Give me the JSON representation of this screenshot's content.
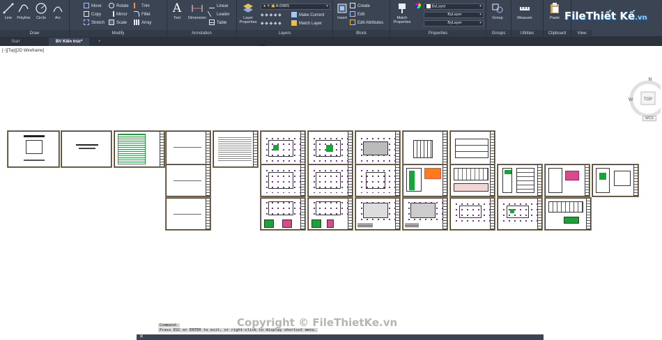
{
  "ribbon": {
    "draw": {
      "title": "Draw",
      "line": "Line",
      "polyline": "Polyline",
      "circle": "Circle",
      "arc": "Arc"
    },
    "modify": {
      "title": "Modify",
      "move": "Move",
      "rotate": "Rotate",
      "trim": "Trim",
      "copy": "Copy",
      "mirror": "Mirror",
      "fillet": "Fillet",
      "stretch": "Stretch",
      "scale": "Scale",
      "array": "Array"
    },
    "annotation": {
      "title": "Annotation",
      "text": "Text",
      "dimension": "Dimension",
      "linear": "Linear",
      "leader": "Leader",
      "table": "Table"
    },
    "layers": {
      "title": "Layers",
      "layer_properties": "Layer Properties",
      "current_layer": "A-DIMS",
      "make_current": "Make Current",
      "match_layer": "Match Layer"
    },
    "block": {
      "title": "Block",
      "insert": "Insert",
      "create": "Create",
      "edit": "Edit",
      "edit_attributes": "Edit Attributes"
    },
    "properties": {
      "title": "Properties",
      "match_properties": "Match Properties",
      "color": "ByLayer",
      "linetype": "ByLayer",
      "lineweight": "ByLayer"
    },
    "groups": {
      "title": "Groups",
      "group": "Group"
    },
    "utilities": {
      "title": "Utilities",
      "measure": "Measure"
    },
    "clipboard": {
      "title": "Clipboard",
      "paste": "Paste"
    },
    "view": {
      "title": "View"
    }
  },
  "logo": {
    "main": "File",
    "accent": "Thiết Kế",
    "suffix": ".vn"
  },
  "tabs": [
    {
      "label": "Start"
    },
    {
      "label": "BV Kiến trúc*"
    },
    {
      "label": "+"
    }
  ],
  "viewport": {
    "label": "[−][Top][2D Wireframe]",
    "viewcube": {
      "n": "N",
      "s": "S",
      "w": "W",
      "top": "TOP"
    },
    "wcs": "WCS"
  },
  "command": {
    "history_1": "Command:",
    "history_2": "Press ESC or ENTER to exit, or right-click to display shortcut menu."
  },
  "watermark": "Copyright © FileThietKe.vn",
  "colors": {
    "ribbon_bg": "#3b4453",
    "tab_bg": "#2c323c",
    "viewport_bg": "#ffffff",
    "sheet_border": "#4a3b2a",
    "plan_accent": "#6b1b8a",
    "plan_green": "#1aa336"
  }
}
